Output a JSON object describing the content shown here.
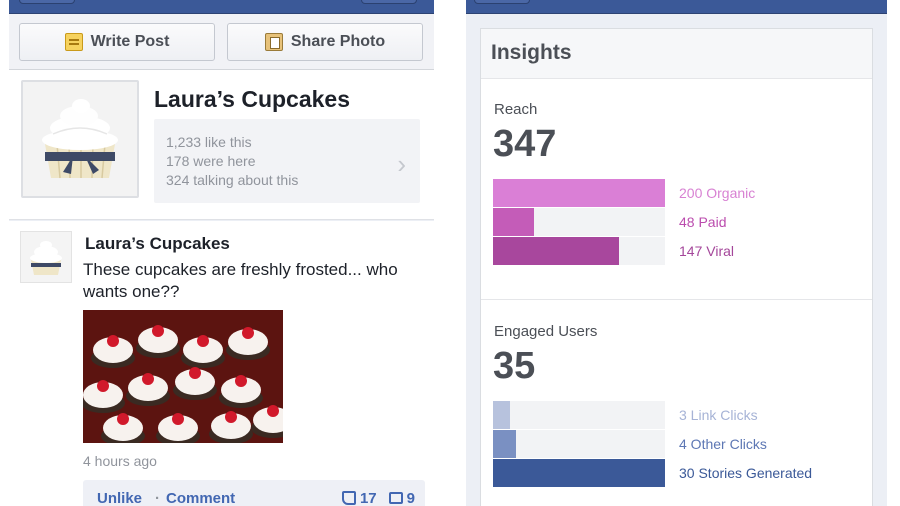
{
  "left": {
    "actions": {
      "write_post": "Write Post",
      "share_photo": "Share Photo"
    },
    "page": {
      "name": "Laura’s Cupcakes",
      "stats": [
        "1,233 like this",
        "178 were here",
        "324 talking about this"
      ]
    },
    "post": {
      "author": "Laura’s Cupcakes",
      "text": "These cupcakes are freshly frosted... who wants one??",
      "time": "4 hours ago",
      "unlike": "Unlike",
      "separator": "·",
      "comment": "Comment",
      "likes": "17",
      "comments": "9"
    }
  },
  "insights": {
    "title": "Insights",
    "reach": {
      "label": "Reach",
      "value": "347",
      "total": 200,
      "items": [
        {
          "label": "200 Organic",
          "value": 200,
          "color": "#da7fd6",
          "text_color": "#d882d3"
        },
        {
          "label": "48 Paid",
          "value": 48,
          "color": "#c45cb8",
          "text_color": "#bb4cae"
        },
        {
          "label": "147 Viral",
          "value": 147,
          "color": "#a8479d",
          "text_color": "#a4469a"
        }
      ]
    },
    "engaged": {
      "label": "Engaged Users",
      "value": "35",
      "total": 30,
      "items": [
        {
          "label": "3 Link Clicks",
          "value": 3,
          "color": "#b7c2dd",
          "text_color": "#a6b3d6"
        },
        {
          "label": "4 Other Clicks",
          "value": 4,
          "color": "#7a90c2",
          "text_color": "#5d77b4"
        },
        {
          "label": "30 Stories Generated",
          "value": 30,
          "color": "#3b5998",
          "text_color": "#3b5998"
        }
      ]
    }
  }
}
